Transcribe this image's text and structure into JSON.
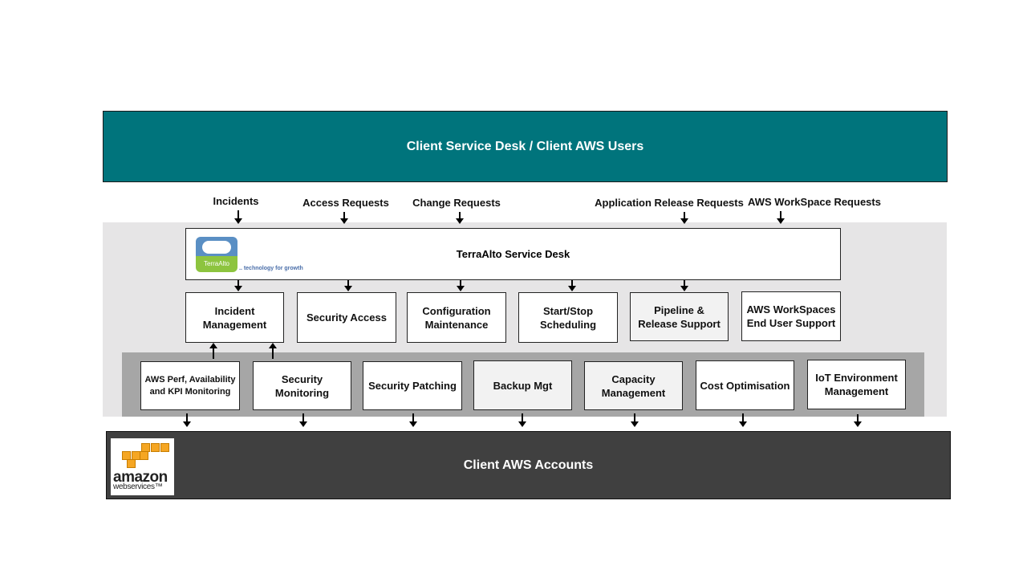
{
  "top": {
    "title": "Client Service Desk / Client AWS Users",
    "color": "#00747c"
  },
  "requests": [
    "Incidents",
    "Access Requests",
    "Change Requests",
    "Application Release Requests",
    "AWS WorkSpace Requests"
  ],
  "service_desk": {
    "title": "TerraAlto Service Desk",
    "logo_text": "TerraAlto",
    "tagline": ".. technology for growth"
  },
  "services": [
    "Incident Management",
    "Security Access",
    "Configuration Maintenance",
    "Start/Stop Scheduling",
    "Pipeline & Release Support",
    "AWS WorkSpaces End User Support"
  ],
  "operations": [
    "AWS Perf, Availability and KPI Monitoring",
    "Security Monitoring",
    "Security Patching",
    "Backup Mgt",
    "Capacity Management",
    "Cost Optimisation",
    "IoT Environment Management"
  ],
  "bottom": {
    "title": "Client AWS Accounts",
    "logo_line1": "amazon",
    "logo_line2": "webservices™",
    "color": "#404040"
  }
}
